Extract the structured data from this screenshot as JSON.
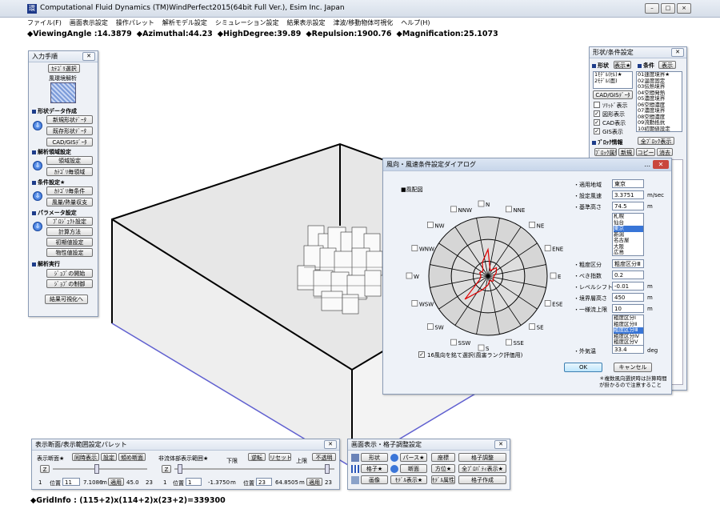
{
  "app": {
    "title": "Computational Fluid Dynamics (TM)WindPerfect2015(64bit Full Ver.), Esim Inc. Japan",
    "logo": "環",
    "win_buttons": [
      "–",
      "□",
      "×"
    ]
  },
  "menu": [
    "ファイル(F)",
    "画面表示設定",
    "操作パレット",
    "解析モデル設定",
    "シミュレーション設定",
    "結果表示設定",
    "津波/移動物体可視化",
    "ヘルプ(H)"
  ],
  "status": {
    "viewing_angle": "◆ViewingAngle :14.3879",
    "azimuthal": "◆Azimuthal:44.23",
    "high_degree": "◆HighDegree:39.89",
    "repulsion": "◆Repulsion:1900.76",
    "magnification": "◆Magnification:25.1073"
  },
  "gridinfo": "◆GridInfo : (115+2)x(114+2)x(23+2)=339300",
  "input_panel": {
    "title": "入力手順",
    "category_btn": "ｶﾃｺﾞﾘ選択",
    "analysis_type": "風環境解析",
    "sections": [
      {
        "label": "形状データ作成",
        "buttons": [
          "新規形状ﾃﾞｰﾀ",
          "既存形状ﾃﾞｰﾀ",
          "CAD/GISﾃﾞｰﾀ"
        ]
      },
      {
        "label": "解析領域設定",
        "buttons": [
          "領域設定",
          "ｶﾃｺﾞﾘ毎領域"
        ]
      },
      {
        "label": "条件設定★",
        "buttons": [
          "ｶﾃｺﾞﾘ毎条件",
          "風量/熱量収支"
        ]
      },
      {
        "label": "パラメータ設定",
        "buttons": [
          "ﾌﾟﾛｼﾞｪｸﾄ設定",
          "計算方法",
          "初期値設定",
          "物性値設定"
        ]
      },
      {
        "label": "解析実行",
        "buttons": [
          "ｼﾞｮﾌﾞの開始",
          "ｼﾞｮﾌﾞの制御"
        ]
      }
    ],
    "result_btn": "結果可視化へ"
  },
  "shape_panel": {
    "title": "形状/条件設定",
    "shape_label": "形状",
    "shape_btn": "表示★",
    "cond_label": "条件",
    "cond_btn": "表示",
    "shape_list": [
      "1ﾓﾃﾞﾙ(ｾﾙ)★",
      "2ﾓﾃﾞﾙ(面)"
    ],
    "cond_list": [
      "01速度境界★",
      "02温度固定",
      "03伝熱境界",
      "04空間発熱",
      "05濃度境界",
      "06空間濃度",
      "07濃度境界",
      "08空間濃度",
      "09流動抵抗",
      "10初期値設定"
    ],
    "cad_btn": "CAD/GISﾃﾞｰﾀ",
    "checks": [
      {
        "label": "ｿﾘｯﾄﾞ表示",
        "checked": false
      },
      {
        "label": "図形表示",
        "checked": true
      },
      {
        "label": "CAD表示",
        "checked": true
      },
      {
        "label": "GIS表示",
        "checked": true
      }
    ],
    "block_label": "ﾌﾞﾛｯｸ情報",
    "all_block_btn": "全ﾌﾞﾛｯｸ表示",
    "block_buttons": [
      "ﾌﾞﾛｯｸ属性",
      "新規",
      "コピー",
      "消去"
    ]
  },
  "dialog": {
    "title": "風向・風速条件設定ダイアログ",
    "windrose_label": "風配図",
    "dirs": [
      "N",
      "NNE",
      "NE",
      "ENE",
      "E",
      "ESE",
      "SE",
      "SSE",
      "S",
      "SSW",
      "SW",
      "WSW",
      "W",
      "WNW",
      "NW",
      "NNW"
    ],
    "rose_values": [
      0.45,
      0.1,
      0.2,
      0.15,
      0.1,
      0.1,
      0.12,
      0.08,
      0.15,
      0.25,
      0.55,
      0.15,
      0.12,
      0.15,
      0.12,
      0.25
    ],
    "check16": "16風向を銘て選択(風害ランク評価用)",
    "fields": [
      {
        "label": "・適用地域",
        "value": "東京",
        "unit": ""
      },
      {
        "label": "・設定風速",
        "value": "3.3751",
        "unit": "m/sec"
      },
      {
        "label": "・基準高さ",
        "value": "74.5",
        "unit": "m"
      }
    ],
    "region_list": [
      "札幌",
      "仙台",
      "東京",
      "新潟",
      "名古屋",
      "大阪",
      "広島"
    ],
    "region_selected": "東京",
    "fields2": [
      {
        "label": "・粗度区分",
        "value": "粗度区分Ⅲ",
        "unit": ""
      },
      {
        "label": "・べき指数",
        "value": "0.2",
        "unit": ""
      },
      {
        "label": "・レベルシフト",
        "value": "-0.01",
        "unit": "m"
      },
      {
        "label": "・境界層高さ",
        "value": "450",
        "unit": "m"
      },
      {
        "label": "・一様流上限",
        "value": "10",
        "unit": "m"
      }
    ],
    "rough_list": [
      "粗度区分Ⅰ",
      "粗度区分Ⅱ",
      "粗度区分Ⅲ",
      "粗度区分Ⅳ",
      "粗度区分Ⅴ"
    ],
    "rough_selected": "粗度区分Ⅲ",
    "temp_label": "・外気温",
    "temp_value": "33.4",
    "temp_unit": "deg",
    "ok": "OK",
    "cancel": "キャンセル",
    "note": "＊複数風向選択時は計算時間が掛かるので注意すること"
  },
  "range_panel": {
    "title": "表示断面/表示範囲設定パレット",
    "sect_label": "表示断面★",
    "btns": [
      "同時表示",
      "設定",
      "傾め断面"
    ],
    "z1": "Z",
    "nonflow_label": "非流体部表示範囲★",
    "lower": "下限",
    "upper": "上限",
    "btns2": [
      "逆転",
      "リセット",
      "不透明"
    ],
    "z2": "Z",
    "row1": {
      "a": "1",
      "pos": "位置",
      "idx": "11",
      "val": "7.1086",
      "unit": "m",
      "apply": "適用",
      "b": "45.0",
      "c": "23"
    },
    "row2": {
      "a": "1",
      "pos": "位置",
      "idx": "1",
      "val": "-1.3750",
      "unit": "m",
      "pos2": "位置",
      "idx2": "23",
      "val2": "64.8505",
      "unit2": "m",
      "apply": "適用",
      "c": "23"
    }
  },
  "grid_panel": {
    "title": "画面表示・格子調整設定",
    "rows": [
      [
        "形状",
        "パース★",
        "座標",
        "格子調整"
      ],
      [
        "格子★",
        "断面",
        "方位★",
        "全ﾌﾟﾛﾊﾟﾃｨ表示★"
      ],
      [
        "画像",
        "ﾓﾃﾞﾙ表示★",
        "ﾓﾃﾞﾙ属性",
        "格子作成"
      ]
    ]
  }
}
